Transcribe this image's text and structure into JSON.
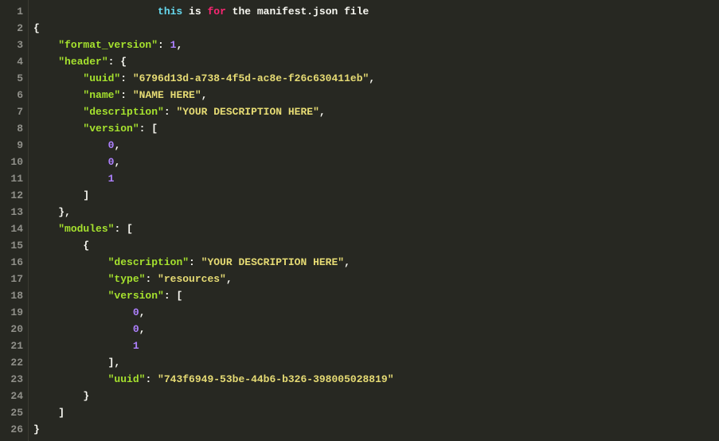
{
  "lines": [
    {
      "n": 1,
      "t": [
        {
          "cls": "p",
          "v": "                    "
        },
        {
          "cls": "k",
          "v": "this"
        },
        {
          "cls": "c",
          "v": " is "
        },
        {
          "cls": "kw",
          "v": "for"
        },
        {
          "cls": "c",
          "v": " the manifest.json file"
        }
      ]
    },
    {
      "n": 2,
      "t": [
        {
          "cls": "p",
          "v": "{"
        }
      ]
    },
    {
      "n": 3,
      "t": [
        {
          "cls": "p",
          "v": "    "
        },
        {
          "cls": "ky",
          "v": "\"format_version\""
        },
        {
          "cls": "p",
          "v": ": "
        },
        {
          "cls": "n",
          "v": "1"
        },
        {
          "cls": "p",
          "v": ","
        }
      ]
    },
    {
      "n": 4,
      "t": [
        {
          "cls": "p",
          "v": "    "
        },
        {
          "cls": "ky",
          "v": "\"header\""
        },
        {
          "cls": "p",
          "v": ": {"
        }
      ]
    },
    {
      "n": 5,
      "t": [
        {
          "cls": "p",
          "v": "        "
        },
        {
          "cls": "ky",
          "v": "\"uuid\""
        },
        {
          "cls": "p",
          "v": ": "
        },
        {
          "cls": "s",
          "v": "\"6796d13d-a738-4f5d-ac8e-f26c630411eb\""
        },
        {
          "cls": "p",
          "v": ","
        }
      ]
    },
    {
      "n": 6,
      "t": [
        {
          "cls": "p",
          "v": "        "
        },
        {
          "cls": "ky",
          "v": "\"name\""
        },
        {
          "cls": "p",
          "v": ": "
        },
        {
          "cls": "s",
          "v": "\"NAME HERE\""
        },
        {
          "cls": "p",
          "v": ","
        }
      ]
    },
    {
      "n": 7,
      "t": [
        {
          "cls": "p",
          "v": "        "
        },
        {
          "cls": "ky",
          "v": "\"description\""
        },
        {
          "cls": "p",
          "v": ": "
        },
        {
          "cls": "s",
          "v": "\"YOUR DESCRIPTION HERE\""
        },
        {
          "cls": "p",
          "v": ","
        }
      ]
    },
    {
      "n": 8,
      "t": [
        {
          "cls": "p",
          "v": "        "
        },
        {
          "cls": "ky",
          "v": "\"version\""
        },
        {
          "cls": "p",
          "v": ": ["
        }
      ]
    },
    {
      "n": 9,
      "t": [
        {
          "cls": "p",
          "v": "            "
        },
        {
          "cls": "n",
          "v": "0"
        },
        {
          "cls": "p",
          "v": ","
        }
      ]
    },
    {
      "n": 10,
      "t": [
        {
          "cls": "p",
          "v": "            "
        },
        {
          "cls": "n",
          "v": "0"
        },
        {
          "cls": "p",
          "v": ","
        }
      ]
    },
    {
      "n": 11,
      "t": [
        {
          "cls": "p",
          "v": "            "
        },
        {
          "cls": "n",
          "v": "1"
        }
      ]
    },
    {
      "n": 12,
      "t": [
        {
          "cls": "p",
          "v": "        ]"
        }
      ]
    },
    {
      "n": 13,
      "t": [
        {
          "cls": "p",
          "v": "    },"
        }
      ]
    },
    {
      "n": 14,
      "t": [
        {
          "cls": "p",
          "v": "    "
        },
        {
          "cls": "ky",
          "v": "\"modules\""
        },
        {
          "cls": "p",
          "v": ": ["
        }
      ]
    },
    {
      "n": 15,
      "t": [
        {
          "cls": "p",
          "v": "        {"
        }
      ]
    },
    {
      "n": 16,
      "t": [
        {
          "cls": "p",
          "v": "            "
        },
        {
          "cls": "ky",
          "v": "\"description\""
        },
        {
          "cls": "p",
          "v": ": "
        },
        {
          "cls": "s",
          "v": "\"YOUR DESCRIPTION HERE\""
        },
        {
          "cls": "p",
          "v": ","
        }
      ]
    },
    {
      "n": 17,
      "t": [
        {
          "cls": "p",
          "v": "            "
        },
        {
          "cls": "ky",
          "v": "\"type\""
        },
        {
          "cls": "p",
          "v": ": "
        },
        {
          "cls": "s",
          "v": "\"resources\""
        },
        {
          "cls": "p",
          "v": ","
        }
      ]
    },
    {
      "n": 18,
      "t": [
        {
          "cls": "p",
          "v": "            "
        },
        {
          "cls": "ky",
          "v": "\"version\""
        },
        {
          "cls": "p",
          "v": ": ["
        }
      ]
    },
    {
      "n": 19,
      "t": [
        {
          "cls": "p",
          "v": "                "
        },
        {
          "cls": "n",
          "v": "0"
        },
        {
          "cls": "p",
          "v": ","
        }
      ]
    },
    {
      "n": 20,
      "t": [
        {
          "cls": "p",
          "v": "                "
        },
        {
          "cls": "n",
          "v": "0"
        },
        {
          "cls": "p",
          "v": ","
        }
      ]
    },
    {
      "n": 21,
      "t": [
        {
          "cls": "p",
          "v": "                "
        },
        {
          "cls": "n",
          "v": "1"
        }
      ]
    },
    {
      "n": 22,
      "t": [
        {
          "cls": "p",
          "v": "            ],"
        }
      ]
    },
    {
      "n": 23,
      "t": [
        {
          "cls": "p",
          "v": "            "
        },
        {
          "cls": "ky",
          "v": "\"uuid\""
        },
        {
          "cls": "p",
          "v": ": "
        },
        {
          "cls": "s",
          "v": "\"743f6949-53be-44b6-b326-398005028819\""
        }
      ]
    },
    {
      "n": 24,
      "t": [
        {
          "cls": "p",
          "v": "        }"
        }
      ]
    },
    {
      "n": 25,
      "t": [
        {
          "cls": "p",
          "v": "    ]"
        }
      ]
    },
    {
      "n": 26,
      "t": [
        {
          "cls": "p",
          "v": "}"
        }
      ]
    }
  ]
}
